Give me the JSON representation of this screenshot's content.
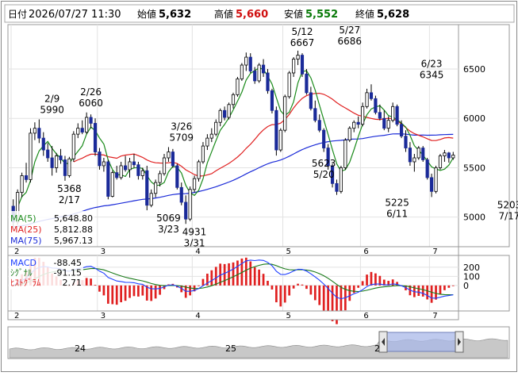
{
  "header": {
    "datetime_label": "日付",
    "datetime": "2026/07/27 11:30",
    "open_label": "始値",
    "open": "5,632",
    "high_label": "高値",
    "high": "5,660",
    "low_label": "安値",
    "low": "5,552",
    "close_label": "終値",
    "close": "5,628"
  },
  "colors": {
    "up": "#ffffff",
    "down": "#1a2a99",
    "ma5": "#1a8a1a",
    "ma25": "#e02020",
    "ma75": "#1a2ad8",
    "macd": "#2040ff",
    "signal": "#1a7a1a",
    "hist": "#e02020",
    "high_val": "#d01010",
    "low_val": "#0a7a0a"
  },
  "legend_price": [
    {
      "name": "MA(5)",
      "value": "5,648.80",
      "color": "#1a8a1a"
    },
    {
      "name": "MA(25)",
      "value": "5,812.88",
      "color": "#e02020"
    },
    {
      "name": "MA(75)",
      "value": "5,967.13",
      "color": "#1a2ad8"
    }
  ],
  "legend_macd": [
    {
      "name": "MACD",
      "value": "-88.45",
      "color": "#2040ff"
    },
    {
      "name": "ｼｸﾞﾅﾙ",
      "value": "-91.15",
      "color": "#1a7a1a"
    },
    {
      "name": "ﾋｽﾄｸﾞﾗﾑ",
      "value": "2.71",
      "color": "#e02020"
    }
  ],
  "navigator_labels": [
    "24",
    "25",
    "2"
  ],
  "chart_data": [
    {
      "type": "candlestick",
      "title": "",
      "months": [
        "2",
        "3",
        "4",
        "5",
        "6",
        "7"
      ],
      "ylim": [
        4700,
        6950
      ],
      "yticks": [
        5000,
        5500,
        6000,
        6500
      ],
      "annotations": [
        {
          "text": [
            "2/9",
            "5990"
          ],
          "x": 9,
          "y": 5990,
          "pos": "above"
        },
        {
          "text": [
            "2/26",
            "6060"
          ],
          "x": 18,
          "y": 6060,
          "pos": "above"
        },
        {
          "text": [
            "5368",
            "2/17"
          ],
          "x": 13,
          "y": 5368,
          "pos": "below"
        },
        {
          "text": [
            "3/26",
            "5709"
          ],
          "x": 39,
          "y": 5709,
          "pos": "above"
        },
        {
          "text": [
            "5069",
            "3/23"
          ],
          "x": 36,
          "y": 5069,
          "pos": "below"
        },
        {
          "text": [
            "4931",
            "3/31"
          ],
          "x": 42,
          "y": 4931,
          "pos": "below"
        },
        {
          "text": [
            "5/12",
            "6667"
          ],
          "x": 67,
          "y": 6667,
          "pos": "above"
        },
        {
          "text": [
            "5/27",
            "6686"
          ],
          "x": 78,
          "y": 6686,
          "pos": "above"
        },
        {
          "text": [
            "5623",
            "5/20"
          ],
          "x": 72,
          "y": 5623,
          "pos": "below"
        },
        {
          "text": [
            "5225",
            "6/11"
          ],
          "x": 89,
          "y": 5225,
          "pos": "below"
        },
        {
          "text": [
            "6/23",
            "6345"
          ],
          "x": 97,
          "y": 6345,
          "pos": "above"
        },
        {
          "text": [
            "5203",
            "7/17"
          ],
          "x": 115,
          "y": 5203,
          "pos": "below"
        }
      ],
      "candles": [
        [
          5110,
          5180,
          4900,
          4950
        ],
        [
          4950,
          5280,
          4920,
          5250
        ],
        [
          5250,
          5450,
          5200,
          5420
        ],
        [
          5420,
          5550,
          5350,
          5380
        ],
        [
          5380,
          5900,
          5350,
          5850
        ],
        [
          5850,
          5960,
          5780,
          5900
        ],
        [
          5900,
          5990,
          5750,
          5800
        ],
        [
          5800,
          5860,
          5620,
          5680
        ],
        [
          5680,
          5750,
          5560,
          5600
        ],
        [
          5600,
          5720,
          5420,
          5500
        ],
        [
          5500,
          5650,
          5450,
          5620
        ],
        [
          5620,
          5690,
          5540,
          5580
        ],
        [
          5580,
          5620,
          5368,
          5420
        ],
        [
          5420,
          5610,
          5400,
          5590
        ],
        [
          5590,
          5870,
          5560,
          5840
        ],
        [
          5840,
          5950,
          5800,
          5900
        ],
        [
          5900,
          5980,
          5840,
          5860
        ],
        [
          5860,
          6060,
          5840,
          6010
        ],
        [
          6010,
          6040,
          5900,
          5950
        ],
        [
          5950,
          6000,
          5620,
          5660
        ],
        [
          5660,
          5700,
          5480,
          5520
        ],
        [
          5520,
          5600,
          5460,
          5560
        ],
        [
          5560,
          5580,
          5180,
          5210
        ],
        [
          5210,
          5470,
          5200,
          5450
        ],
        [
          5450,
          5520,
          5380,
          5400
        ],
        [
          5400,
          5560,
          5380,
          5520
        ],
        [
          5520,
          5620,
          5460,
          5480
        ],
        [
          5480,
          5600,
          5400,
          5560
        ],
        [
          5560,
          5640,
          5500,
          5530
        ],
        [
          5530,
          5560,
          5380,
          5420
        ],
        [
          5420,
          5500,
          5380,
          5470
        ],
        [
          5470,
          5520,
          5069,
          5120
        ],
        [
          5120,
          5280,
          5100,
          5240
        ],
        [
          5240,
          5380,
          5200,
          5350
        ],
        [
          5350,
          5470,
          5310,
          5440
        ],
        [
          5440,
          5640,
          5420,
          5600
        ],
        [
          5600,
          5709,
          5560,
          5660
        ],
        [
          5660,
          5690,
          5500,
          5520
        ],
        [
          5520,
          5540,
          5280,
          5300
        ],
        [
          5300,
          5350,
          5120,
          5150
        ],
        [
          5150,
          5220,
          4931,
          4980
        ],
        [
          4980,
          5310,
          4960,
          5280
        ],
        [
          5280,
          5420,
          5250,
          5390
        ],
        [
          5390,
          5580,
          5360,
          5560
        ],
        [
          5560,
          5760,
          5540,
          5720
        ],
        [
          5720,
          5840,
          5680,
          5800
        ],
        [
          5800,
          5900,
          5760,
          5840
        ],
        [
          5840,
          5990,
          5820,
          5960
        ],
        [
          5960,
          6100,
          5920,
          6080
        ],
        [
          6080,
          6120,
          5980,
          6010
        ],
        [
          6010,
          6160,
          5990,
          6140
        ],
        [
          6140,
          6260,
          6100,
          6240
        ],
        [
          6240,
          6420,
          6220,
          6400
        ],
        [
          6400,
          6560,
          6380,
          6540
        ],
        [
          6540,
          6667,
          6480,
          6620
        ],
        [
          6620,
          6660,
          6460,
          6480
        ],
        [
          6480,
          6520,
          6350,
          6380
        ],
        [
          6380,
          6560,
          6360,
          6540
        ],
        [
          6540,
          6600,
          6420,
          6460
        ],
        [
          6460,
          6500,
          6250,
          6280
        ],
        [
          6280,
          6300,
          6050,
          6080
        ],
        [
          6080,
          6120,
          5623,
          5680
        ],
        [
          5680,
          5900,
          5660,
          5880
        ],
        [
          5880,
          6240,
          5860,
          6220
        ],
        [
          6220,
          6480,
          6200,
          6460
        ],
        [
          6460,
          6620,
          6420,
          6600
        ],
        [
          6600,
          6686,
          6540,
          6640
        ],
        [
          6640,
          6660,
          6420,
          6450
        ],
        [
          6450,
          6500,
          6240,
          6260
        ],
        [
          6260,
          6320,
          6080,
          6100
        ],
        [
          6100,
          6180,
          5960,
          5980
        ],
        [
          5980,
          6040,
          5860,
          5880
        ],
        [
          5880,
          5900,
          5660,
          5700
        ],
        [
          5700,
          5740,
          5480,
          5520
        ],
        [
          5520,
          5540,
          5300,
          5340
        ],
        [
          5340,
          5380,
          5225,
          5260
        ],
        [
          5260,
          5520,
          5240,
          5500
        ],
        [
          5500,
          5800,
          5480,
          5780
        ],
        [
          5780,
          5920,
          5760,
          5900
        ],
        [
          5900,
          5980,
          5860,
          5960
        ],
        [
          5960,
          6020,
          5900,
          5940
        ],
        [
          5940,
          6160,
          5920,
          6120
        ],
        [
          6120,
          6300,
          6100,
          6260
        ],
        [
          6260,
          6345,
          6180,
          6200
        ],
        [
          6200,
          6230,
          6040,
          6060
        ],
        [
          6060,
          6140,
          5980,
          6000
        ],
        [
          6000,
          6080,
          5880,
          5900
        ],
        [
          5900,
          6020,
          5860,
          5980
        ],
        [
          5980,
          6160,
          5960,
          6120
        ],
        [
          6120,
          6140,
          5920,
          5940
        ],
        [
          5940,
          5980,
          5800,
          5820
        ],
        [
          5820,
          5880,
          5660,
          5700
        ],
        [
          5700,
          5760,
          5520,
          5560
        ],
        [
          5560,
          5640,
          5460,
          5600
        ],
        [
          5600,
          5720,
          5580,
          5700
        ],
        [
          5700,
          5720,
          5560,
          5580
        ],
        [
          5580,
          5600,
          5380,
          5400
        ],
        [
          5400,
          5440,
          5203,
          5260
        ],
        [
          5260,
          5520,
          5240,
          5500
        ],
        [
          5500,
          5640,
          5480,
          5620
        ],
        [
          5620,
          5680,
          5560,
          5650
        ],
        [
          5650,
          5660,
          5552,
          5600
        ],
        [
          5600,
          5660,
          5580,
          5628
        ]
      ],
      "month_start_index": [
        0,
        20,
        42,
        63,
        81,
        97
      ],
      "series": [
        {
          "name": "MA(5)",
          "values": "derived_from_candles",
          "color": "#1a8a1a"
        },
        {
          "name": "MA(25)",
          "values": "derived_from_candles",
          "color": "#e02020"
        },
        {
          "name": "MA(75)",
          "values": "derived_from_candles",
          "color": "#1a2ad8"
        }
      ]
    },
    {
      "type": "line+bar",
      "title": "",
      "ylim": [
        -280,
        330
      ],
      "yticks": [
        200,
        100,
        0
      ],
      "series": [
        {
          "name": "MACD",
          "color": "#2040ff"
        },
        {
          "name": "ｼｸﾞﾅﾙ",
          "color": "#1a7a1a"
        },
        {
          "name": "ﾋｽﾄｸﾞﾗﾑ",
          "color": "#e02020"
        }
      ]
    }
  ]
}
